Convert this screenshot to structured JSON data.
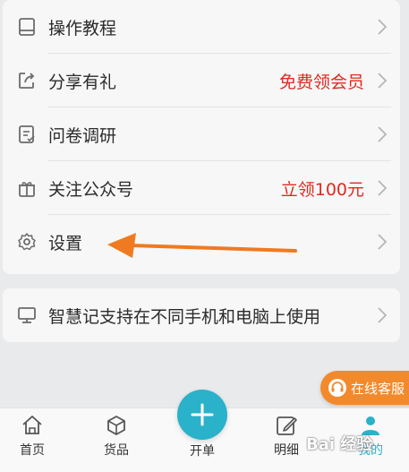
{
  "menu": {
    "items": [
      {
        "label": "操作教程",
        "extra": "",
        "icon": "book-icon"
      },
      {
        "label": "分享有礼",
        "extra": "免费领会员",
        "icon": "share-icon"
      },
      {
        "label": "问卷调研",
        "extra": "",
        "icon": "survey-icon"
      },
      {
        "label": "关注公众号",
        "extra": "立领100元",
        "icon": "gift-icon"
      },
      {
        "label": "设置",
        "extra": "",
        "icon": "gear-icon"
      }
    ]
  },
  "device": {
    "label": "智慧记支持在不同手机和电脑上使用",
    "icon": "monitor-icon"
  },
  "service": {
    "label": "在线客服",
    "icon": "headset-icon"
  },
  "tabbar": {
    "home": "首页",
    "goods": "货品",
    "new_order": "开单",
    "details": "明细",
    "me": "我的"
  },
  "watermark": "Bai 经验",
  "colors": {
    "accent": "#29b2c9",
    "highlight_text": "#e02a1f",
    "annotation_arrow": "#f07a1f",
    "service_pill": "#f28a2b"
  }
}
